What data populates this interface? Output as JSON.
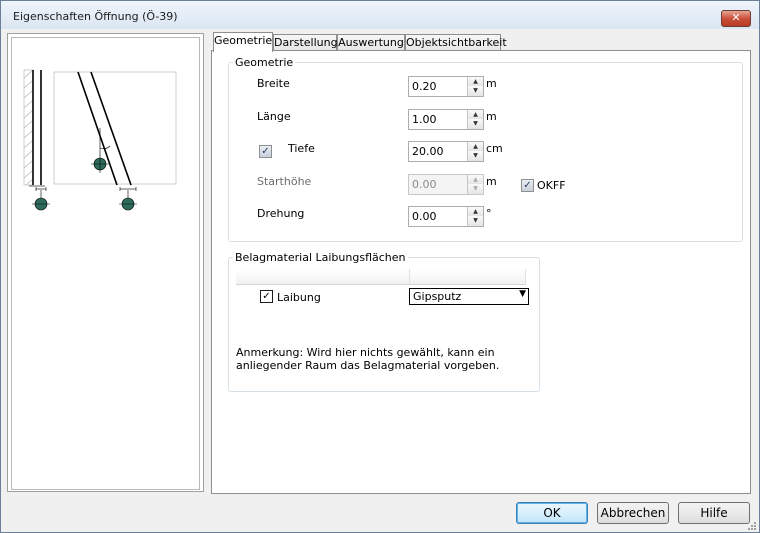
{
  "window": {
    "title": "Eigenschaften Öffnung (Ö-39)",
    "close_glyph": "✕"
  },
  "tabs": [
    {
      "label": "Geometrie",
      "active": true
    },
    {
      "label": "Darstellung",
      "active": false
    },
    {
      "label": "Auswertung",
      "active": false
    },
    {
      "label": "Objektsichtbarkeit",
      "active": false
    }
  ],
  "geometrie": {
    "group_label": "Geometrie",
    "breite": {
      "label": "Breite",
      "value": "0.20",
      "unit": "m"
    },
    "laenge": {
      "label": "Länge",
      "value": "1.00",
      "unit": "m"
    },
    "tiefe": {
      "label": "Tiefe",
      "value": "20.00",
      "unit": "cm",
      "checked": true
    },
    "starthoehe": {
      "label": "Starthöhe",
      "value": "0.00",
      "unit": "m",
      "disabled": true
    },
    "okff": {
      "label": "OKFF",
      "checked": true
    },
    "drehung": {
      "label": "Drehung",
      "value": "0.00",
      "unit": "°"
    }
  },
  "belag": {
    "group_label": "Belagmaterial Laibungsflächen",
    "laibung_label": "Laibung",
    "laibung_checked": true,
    "material_value": "Gipsputz",
    "note": "Anmerkung:   Wird hier nichts gewählt, kann ein anliegender Raum das Belagmaterial vorgeben."
  },
  "buttons": {
    "ok": "OK",
    "cancel": "Abbrechen",
    "help": "Hilfe"
  },
  "colors": {
    "marker": "#2f6b5b",
    "default_button_border": "#3c7fb1",
    "close_button": "#c9503a"
  }
}
